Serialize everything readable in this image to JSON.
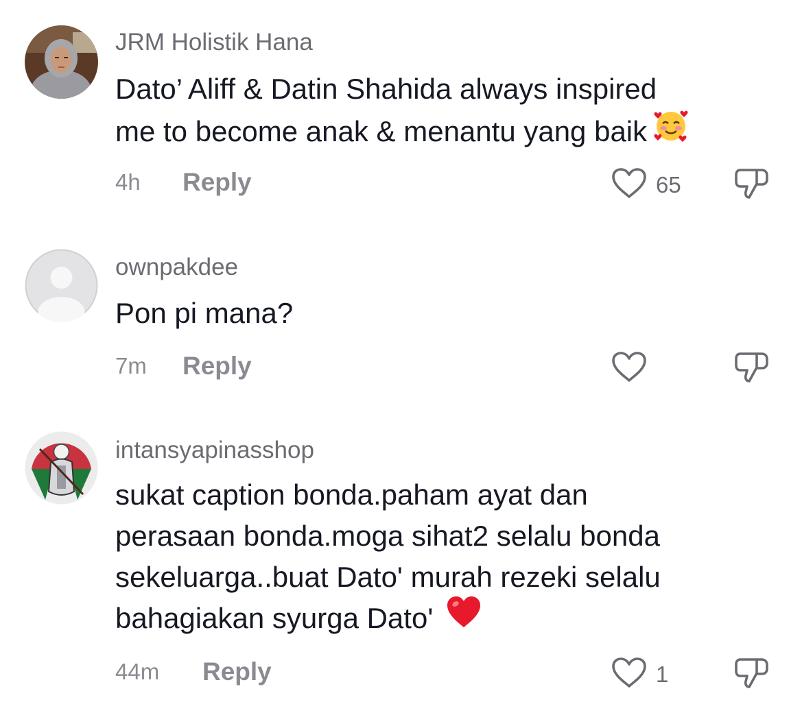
{
  "comments": [
    {
      "username": "JRM Holistik Hana",
      "text_lines": [
        "Dato’ Aliff & Datin Shahida always inspired",
        "me to become anak & menantu yang baik"
      ],
      "emoji_icon": "smiling-face-with-hearts-emoji",
      "time": "4h",
      "reply_label": "Reply",
      "like_count": "65",
      "avatar": "profile-photo-woman-grey-hijab"
    },
    {
      "username": "ownpakdee",
      "text_lines": [
        "Pon pi mana?"
      ],
      "time": "7m",
      "reply_label": "Reply",
      "like_count": "",
      "avatar": "default-grey-avatar"
    },
    {
      "username": "intansyapinasshop",
      "text_lines": [
        "sukat caption bonda.paham ayat dan",
        "perasaan bonda.moga sihat2 selalu bonda",
        "sekeluarga..buat Dato' murah rezeki selalu",
        "bahagiakan syurga Dato'"
      ],
      "emoji_icon": "red-heart-emoji",
      "time": "44m",
      "reply_label": "Reply",
      "like_count": "1",
      "avatar": "warrior-illustration-avatar"
    }
  ],
  "icons": {
    "like": "heart-outline-icon",
    "dislike": "thumbs-down-icon"
  },
  "colors": {
    "text": "#161823",
    "username": "#6b6c72",
    "meta": "#8a8b91",
    "icon": "#6b6c72",
    "heart_emoji": "#e8192c"
  }
}
